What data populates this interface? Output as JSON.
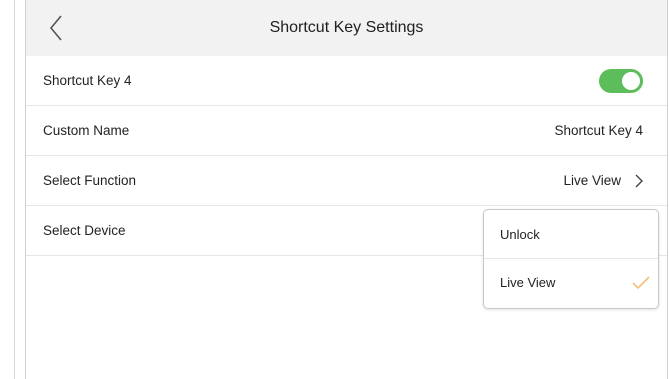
{
  "header": {
    "title": "Shortcut Key Settings",
    "back_icon": "chevron-left-icon"
  },
  "rows": {
    "shortcut_key": {
      "label": "Shortcut Key 4",
      "toggle_on": true
    },
    "custom_name": {
      "label": "Custom Name",
      "value": "Shortcut Key 4"
    },
    "select_function": {
      "label": "Select Function",
      "value": "Live View",
      "icon": "chevron-right-icon"
    },
    "select_device": {
      "label": "Select Device"
    }
  },
  "dropdown": {
    "options": [
      {
        "label": "Unlock",
        "selected": false
      },
      {
        "label": "Live View",
        "selected": true
      }
    ],
    "check_icon": "checkmark-icon"
  },
  "colors": {
    "toggle_on": "#5cbd5a",
    "check": "#f2b96b",
    "header_bg": "#f2f2f2"
  }
}
